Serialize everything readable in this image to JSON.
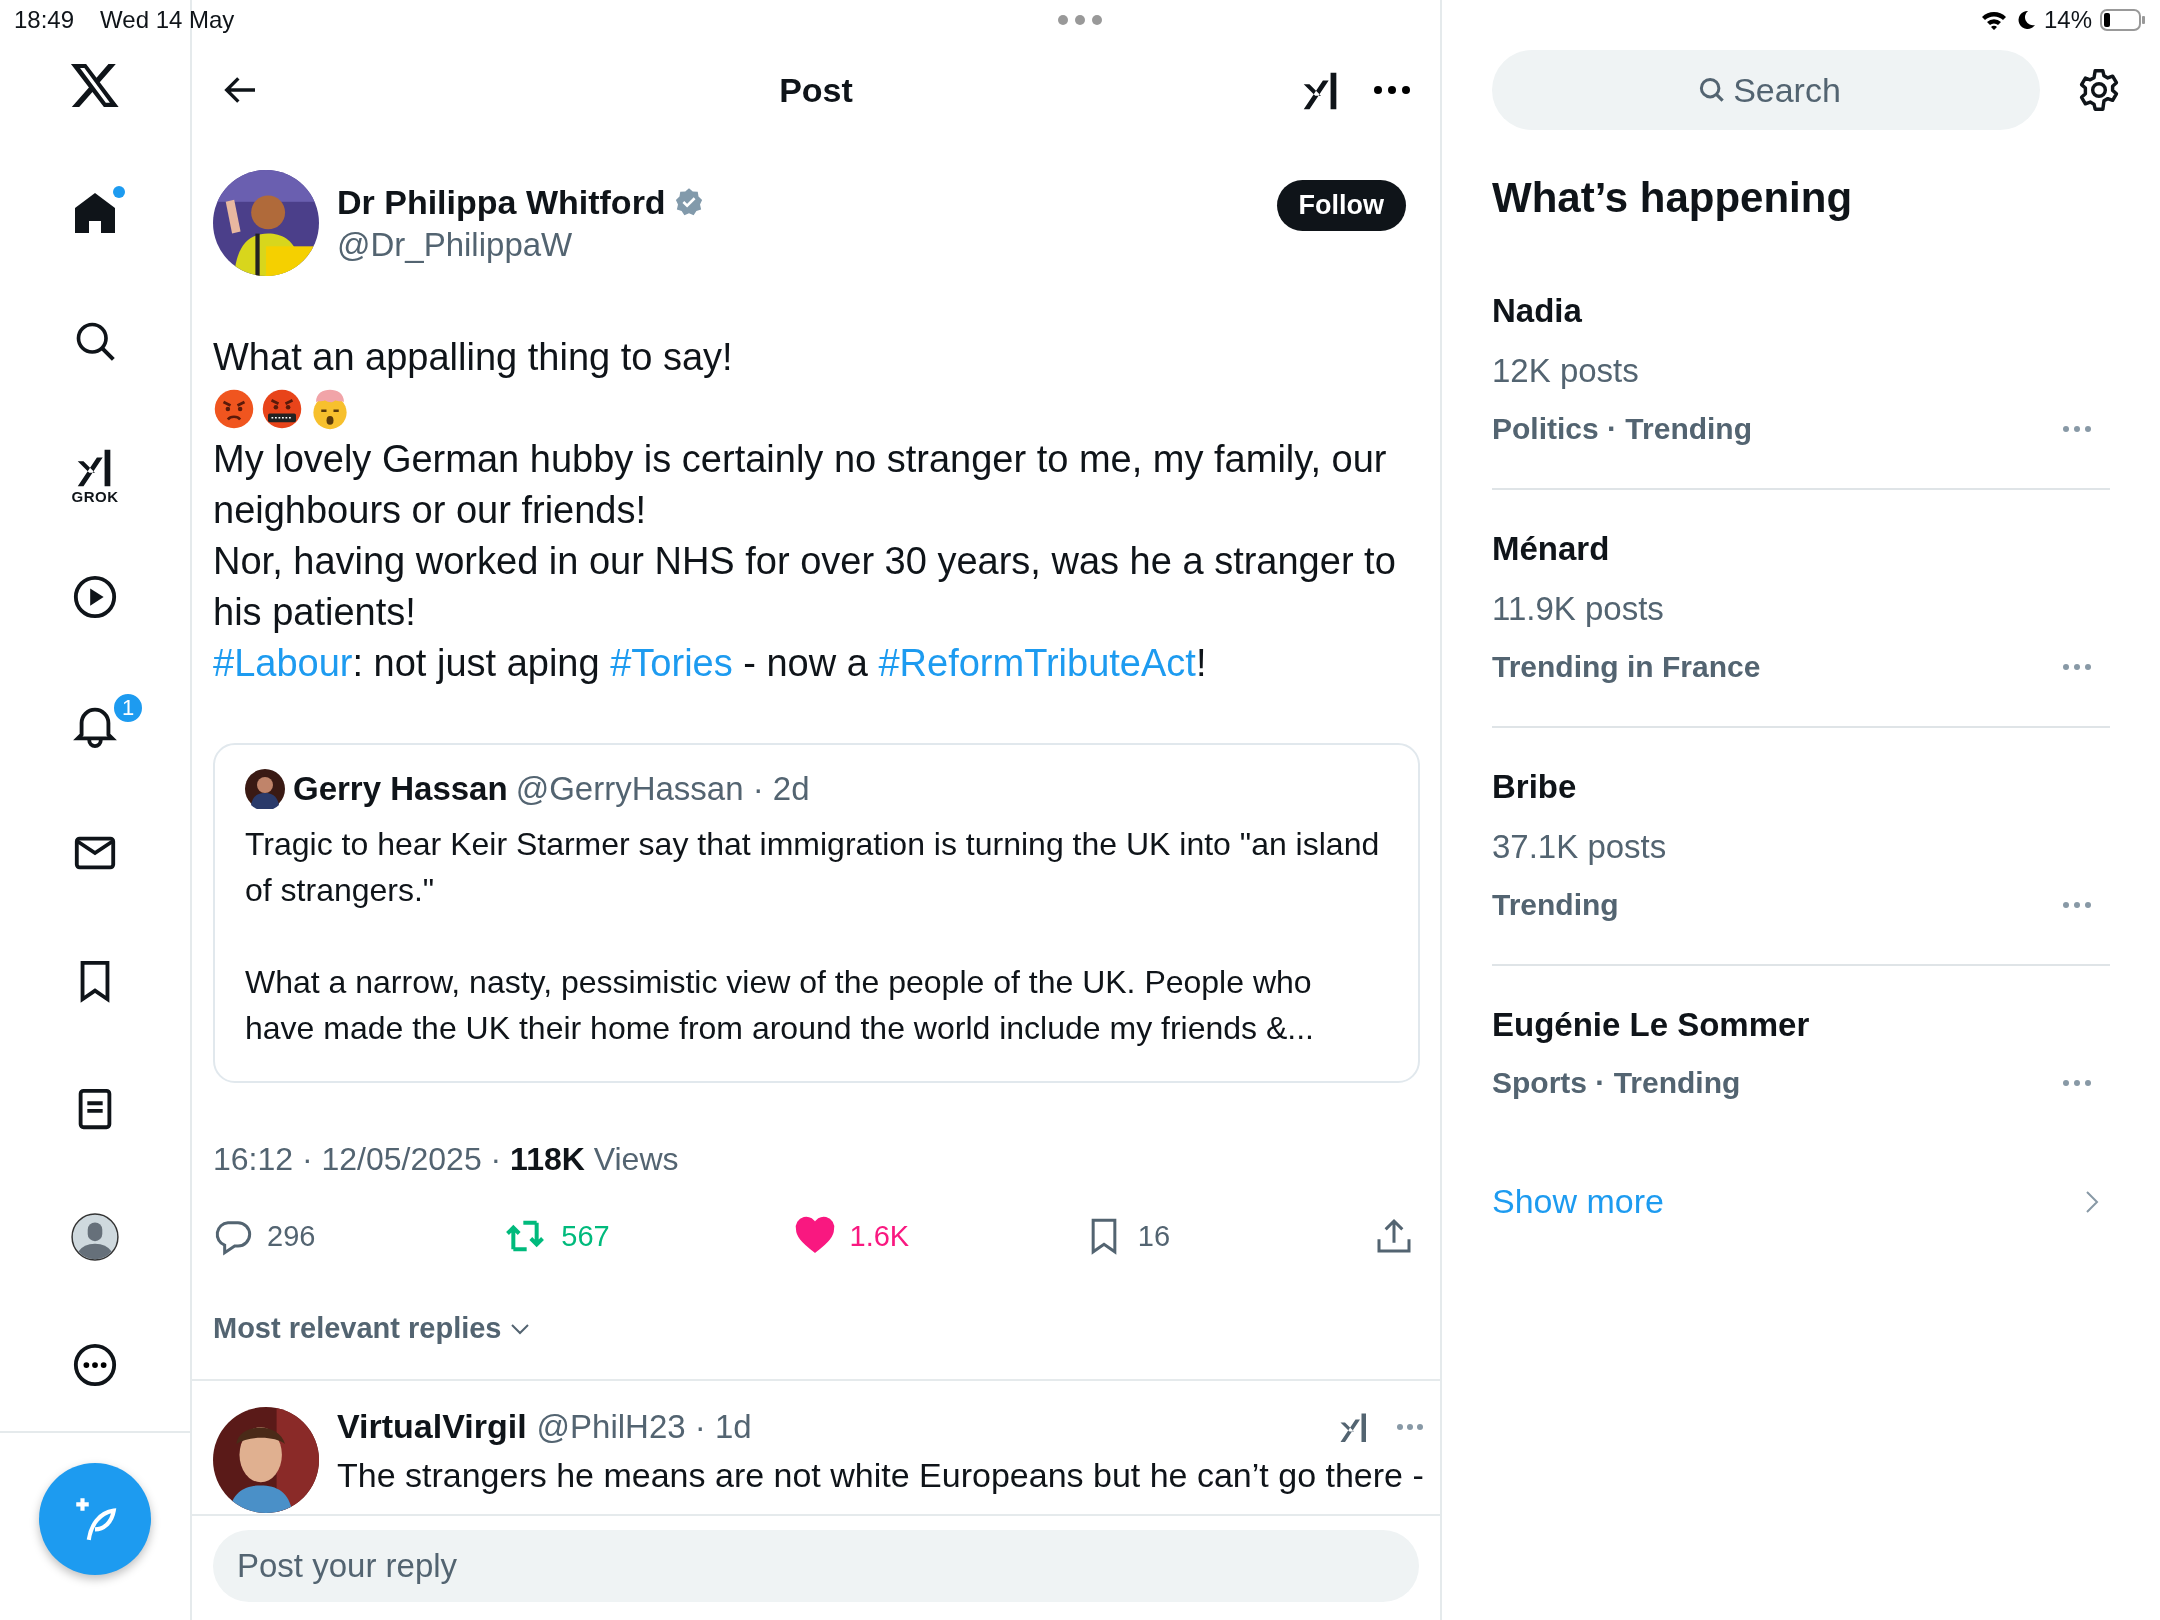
{
  "status_bar": {
    "time": "18:49",
    "date": "Wed 14 May",
    "battery": "14%"
  },
  "nav": [
    {
      "kind": "logo",
      "dot": false
    },
    {
      "kind": "home",
      "dot": true
    },
    {
      "kind": "search",
      "dot": false
    },
    {
      "kind": "grok",
      "label": "GROK",
      "dot": false
    },
    {
      "kind": "video",
      "dot": false
    },
    {
      "kind": "notifications",
      "badge": "1",
      "dot": false
    },
    {
      "kind": "messages",
      "dot": false
    },
    {
      "kind": "bookmarks",
      "dot": false
    },
    {
      "kind": "lists",
      "dot": false
    },
    {
      "kind": "profile",
      "dot": false
    },
    {
      "kind": "more",
      "dot": false
    }
  ],
  "header": {
    "title": "Post"
  },
  "post": {
    "author": {
      "name": "Dr Philippa Whitford",
      "handle": "@Dr_PhilippaW",
      "verified": true
    },
    "follow_label": "Follow",
    "body": [
      {
        "kind": "text",
        "text": "What an appalling thing to say!"
      },
      {
        "kind": "emoji_row"
      },
      {
        "kind": "text",
        "text": "My lovely German hubby is certainly no stranger to me, my family, our neighbours or our friends!"
      },
      {
        "kind": "text",
        "text": "Nor, having worked in our NHS for over 30 years, was he a stranger to his patients!"
      },
      {
        "kind": "segments",
        "segments": [
          {
            "kind": "hashtag",
            "text": "#Labour"
          },
          {
            "kind": "plain",
            "text": ": not just aping "
          },
          {
            "kind": "hashtag",
            "text": "#Tories"
          },
          {
            "kind": "plain",
            "text": " - now a "
          },
          {
            "kind": "hashtag",
            "text": "#ReformTributeAct"
          },
          {
            "kind": "plain",
            "text": "!"
          }
        ]
      }
    ],
    "quote": {
      "name": "Gerry Hassan",
      "meta": "@GerryHassan · 2d",
      "paragraphs": [
        "Tragic to hear Keir Starmer say that immigration is turning the UK into \"an island of strangers.\"",
        "What a narrow, nasty, pessimistic view of the people of the UK. People who have made the UK their home from around the world include my friends &..."
      ]
    },
    "info": "16:12 · 12/05/2025 · **118K** Views",
    "actions": [
      {
        "kind": "reply",
        "count": "296",
        "active": false
      },
      {
        "kind": "repost",
        "count": "567",
        "active": true
      },
      {
        "kind": "like",
        "count": "1.6K",
        "active": true
      },
      {
        "kind": "bookmark",
        "count": "16",
        "active": false
      },
      {
        "kind": "share",
        "active": false
      }
    ]
  },
  "sort_label": "Most relevant replies",
  "reply": {
    "name": "VirtualVirgil",
    "meta": "@PhilH23 · 1d",
    "text": "The strangers he means are not white Europeans but he can’t go there -"
  },
  "reply_field": {
    "placeholder": "Post your reply"
  },
  "sidebar": {
    "search": {
      "placeholder": "Search"
    },
    "heading": "What’s happening",
    "trends": [
      {
        "name": "Nadia",
        "posts": "12K posts",
        "category": "Politics · Trending"
      },
      {
        "name": "Ménard",
        "posts": "11.9K posts",
        "category": "Trending in France"
      },
      {
        "name": "Bribe",
        "posts": "37.1K posts",
        "category": "Trending"
      },
      {
        "name": "Eugénie Le Sommer",
        "category": "Sports · Trending"
      }
    ],
    "show_more": "Show more"
  }
}
